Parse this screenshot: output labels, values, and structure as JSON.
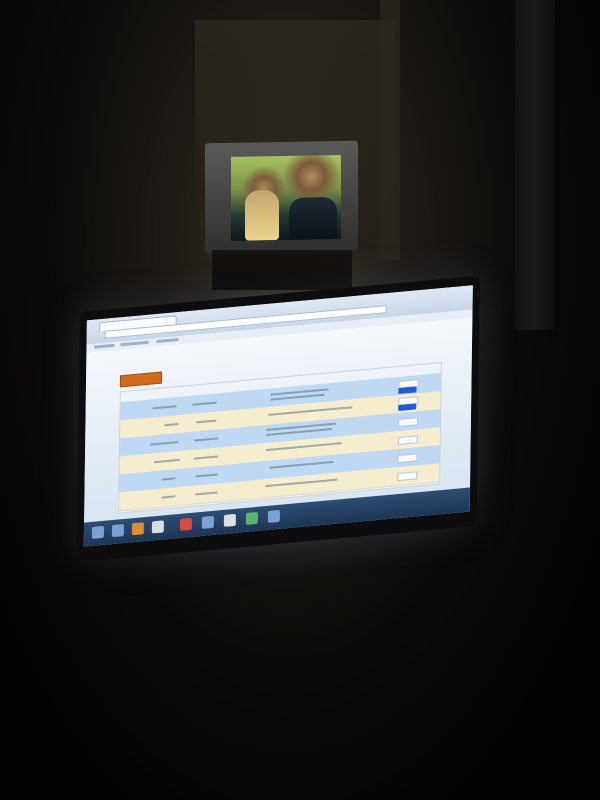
{
  "scene": {
    "background_colors": {
      "room": "#0b0a08",
      "screen_blue": "#bfd8f3",
      "accent_orange": "#d26a1c",
      "button_blue": "#1d5cd9"
    },
    "visible_elements": [
      "dark-room",
      "crt-tv",
      "tv-screen-image",
      "computer-monitor",
      "browser-window",
      "orange-button",
      "data-table",
      "windows-taskbar"
    ],
    "tv": {
      "content_icon": "movie-scene-icon"
    },
    "monitor": {
      "table_rows": 6,
      "taskbar_icons": [
        "start-icon",
        "browser-icon",
        "folder-icon",
        "media-icon",
        "chrome-icon",
        "app-icon",
        "app-icon",
        "app-icon",
        "app-icon"
      ]
    }
  }
}
